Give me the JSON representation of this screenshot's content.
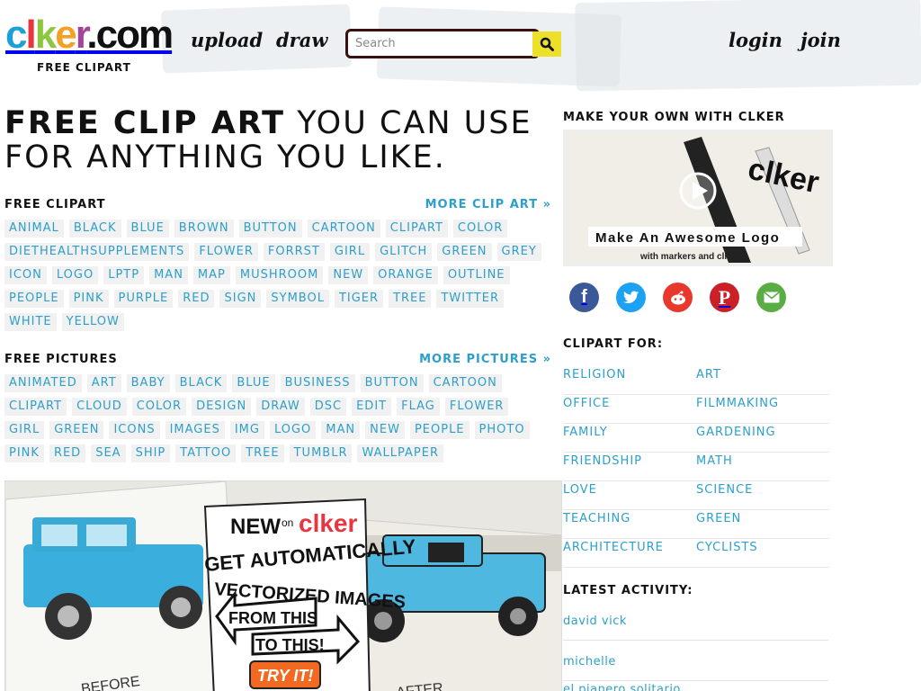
{
  "header": {
    "logo_text": "clker.com",
    "logo_subtitle": "FREE CLIPART",
    "nav": {
      "upload": "upload",
      "draw": "draw",
      "login": "login",
      "join": "join"
    },
    "search_placeholder": "Search"
  },
  "headline": {
    "bold": "FREE CLIP ART",
    "rest": " YOU CAN USE FOR ANYTHING YOU LIKE."
  },
  "free_clipart": {
    "title": "FREE CLIPART",
    "more": "MORE CLIP ART »",
    "tags": [
      "ANIMAL",
      "BLACK",
      "BLUE",
      "BROWN",
      "BUTTON",
      "CARTOON",
      "CLIPART",
      "COLOR",
      "DIETHEALTHSUPPLEMENTS",
      "FLOWER",
      "FORRST",
      "GIRL",
      "GLITCH",
      "GREEN",
      "GREY",
      "ICON",
      "LOGO",
      "LPTP",
      "MAN",
      "MAP",
      "MUSHROOM",
      "NEW",
      "ORANGE",
      "OUTLINE",
      "PEOPLE",
      "PINK",
      "PURPLE",
      "RED",
      "SIGN",
      "SYMBOL",
      "TIGER",
      "TREE",
      "TWITTER",
      "WHITE",
      "YELLOW"
    ]
  },
  "free_pictures": {
    "title": "FREE PICTURES",
    "more": "MORE PICTURES »",
    "tags": [
      "ANIMATED",
      "ART",
      "BABY",
      "BLACK",
      "BLUE",
      "BUSINESS",
      "BUTTON",
      "CARTOON",
      "CLIPART",
      "CLOUD",
      "COLOR",
      "DESIGN",
      "DRAW",
      "DSC",
      "EDIT",
      "FLAG",
      "FLOWER",
      "GIRL",
      "GREEN",
      "ICONS",
      "IMAGES",
      "IMG",
      "LOGO",
      "MAN",
      "NEW",
      "PEOPLE",
      "PHOTO",
      "PINK",
      "RED",
      "SEA",
      "SHIP",
      "TATTOO",
      "TREE",
      "TUMBLR",
      "WALLPAPER"
    ]
  },
  "promo": {
    "new_on": "NEW",
    "on": "on",
    "brand": "clker",
    "line1": "GET AUTOMATICALLY",
    "line2": "VECTORIZED IMAGES",
    "from": "FROM THIS",
    "to": "TO THIS!",
    "try": "TRY IT!",
    "before": "BEFORE",
    "after": "AFTER"
  },
  "sidebar": {
    "make_title": "MAKE YOUR OWN WITH CLKER",
    "video_caption": "Make An Awesome Logo",
    "video_sub": "with markers and clker",
    "video_brand": "clker",
    "clipart_for_title": "CLIPART FOR:",
    "categories_left": [
      "RELIGION",
      "OFFICE",
      "FAMILY",
      "FRIENDSHIP",
      "LOVE",
      "TEACHING",
      "ARCHITECTURE"
    ],
    "categories_right": [
      "ART",
      "FILMMAKING",
      "GARDENING",
      "MATH",
      "SCIENCE",
      "GREEN",
      "CYCLISTS"
    ],
    "activity_title": "LATEST ACTIVITY:",
    "activity": [
      "david vick",
      "michelle",
      "el pianero solitario"
    ]
  },
  "colors": {
    "accent": "#2d9fc9",
    "search_button": "#ede028",
    "tag_bg": "#f1f1f1"
  },
  "icons": {
    "social": [
      "facebook-icon",
      "twitter-icon",
      "reddit-icon",
      "pinterest-icon",
      "email-icon"
    ]
  }
}
